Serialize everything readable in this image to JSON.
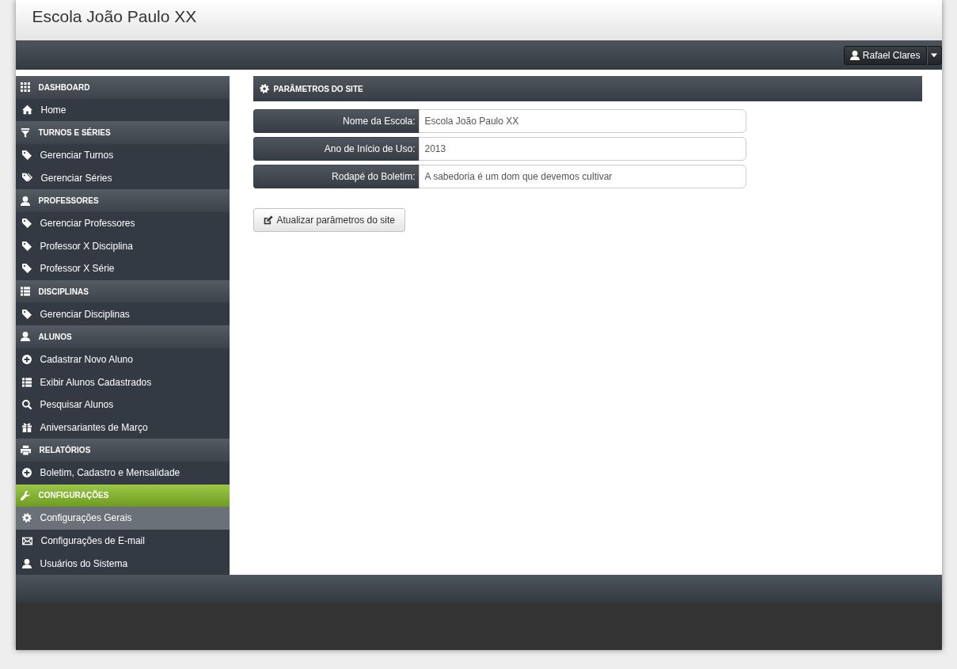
{
  "header": {
    "title": "Escola João Paulo XX"
  },
  "user_menu": {
    "name": "Rafael Clares"
  },
  "sidebar": {
    "sections": [
      {
        "title": "DASHBOARD",
        "active": false,
        "items": [
          {
            "label": "Home",
            "selected": false
          }
        ]
      },
      {
        "title": "TURNOS E SÉRIES",
        "active": false,
        "items": [
          {
            "label": "Gerenciar Turnos",
            "selected": false
          },
          {
            "label": "Gerenciar Séries",
            "selected": false
          }
        ]
      },
      {
        "title": "PROFESSORES",
        "active": false,
        "items": [
          {
            "label": "Gerenciar Professores",
            "selected": false
          },
          {
            "label": "Professor X Disciplina",
            "selected": false
          },
          {
            "label": "Professor X Série",
            "selected": false
          }
        ]
      },
      {
        "title": "DISCIPLINAS",
        "active": false,
        "items": [
          {
            "label": "Gerenciar Disciplinas",
            "selected": false
          }
        ]
      },
      {
        "title": "ALUNOS",
        "active": false,
        "items": [
          {
            "label": "Cadastrar Novo Aluno",
            "selected": false
          },
          {
            "label": "Exibir Alunos Cadastrados",
            "selected": false
          },
          {
            "label": "Pesquisar Alunos",
            "selected": false
          },
          {
            "label": "Aniversariantes de Março",
            "selected": false
          }
        ]
      },
      {
        "title": "RELATÓRIOS",
        "active": false,
        "items": [
          {
            "label": "Boletim, Cadastro e Mensalidade",
            "selected": false
          }
        ]
      },
      {
        "title": "CONFIGURAÇÕES",
        "active": true,
        "items": [
          {
            "label": "Configurações Gerais",
            "selected": true
          },
          {
            "label": "Configurações de E-mail",
            "selected": false
          },
          {
            "label": "Usuários do Sistema",
            "selected": false
          }
        ]
      }
    ]
  },
  "panel": {
    "title": "PARÂMETROS DO SITE",
    "fields": [
      {
        "label": "Nome da Escola:",
        "value": "Escola João Paulo XX"
      },
      {
        "label": "Ano de Início de Uso:",
        "value": "2013"
      },
      {
        "label": "Rodapé do Boletim:",
        "value": "A sabedoria é um dom que devemos cultivar"
      }
    ],
    "submit_button": {
      "label": "Atualizar parâmetros do site"
    }
  }
}
